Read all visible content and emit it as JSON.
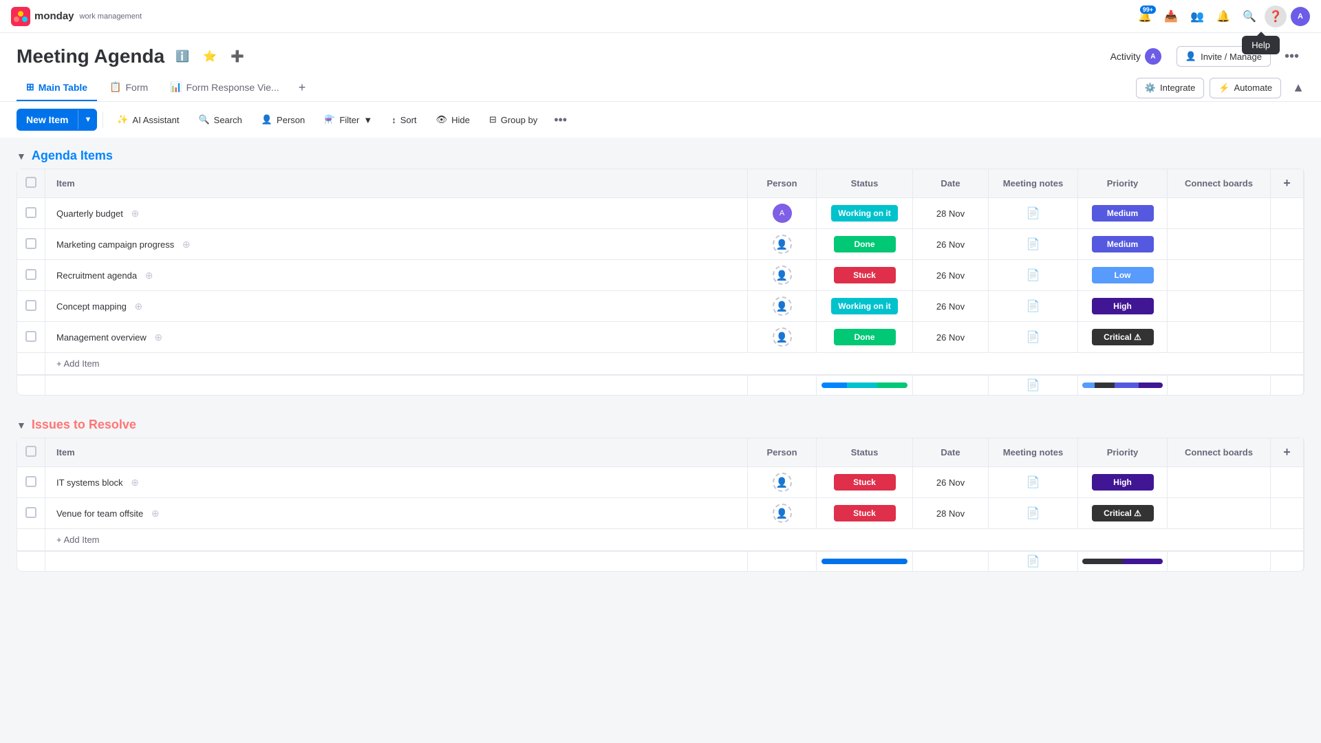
{
  "app": {
    "name": "monday",
    "subtitle": "work management",
    "notification_badge": "99+"
  },
  "header": {
    "title": "Meeting Agenda",
    "activity_label": "Activity",
    "invite_label": "Invite / Manage",
    "help_tooltip": "Help"
  },
  "tabs": [
    {
      "label": "Main Table",
      "icon": "table-icon",
      "active": true
    },
    {
      "label": "Form",
      "icon": "form-icon",
      "active": false
    },
    {
      "label": "Form Response Vie...",
      "icon": "view-icon",
      "active": false
    }
  ],
  "integrate_label": "Integrate",
  "automate_label": "Automate",
  "toolbar": {
    "new_item": "New Item",
    "ai_assistant": "AI Assistant",
    "search": "Search",
    "person": "Person",
    "filter": "Filter",
    "sort": "Sort",
    "hide": "Hide",
    "group_by": "Group by"
  },
  "groups": [
    {
      "id": "agenda",
      "title": "Agenda Items",
      "color": "#0085ff",
      "columns": [
        "Item",
        "Person",
        "Status",
        "Date",
        "Meeting notes",
        "Priority",
        "Connect boards"
      ],
      "rows": [
        {
          "item": "Quarterly budget",
          "person": "avatar",
          "status": "Working on it",
          "status_class": "status-working",
          "date": "28 Nov",
          "has_note": true,
          "priority": "Medium",
          "priority_class": "priority-medium"
        },
        {
          "item": "Marketing campaign progress",
          "person": "empty",
          "status": "Done",
          "status_class": "status-done",
          "date": "26 Nov",
          "has_note": false,
          "priority": "Medium",
          "priority_class": "priority-medium"
        },
        {
          "item": "Recruitment agenda",
          "person": "empty",
          "status": "Stuck",
          "status_class": "status-stuck",
          "date": "26 Nov",
          "has_note": false,
          "priority": "Low",
          "priority_class": "priority-low"
        },
        {
          "item": "Concept mapping",
          "person": "empty",
          "status": "Working on it",
          "status_class": "status-working",
          "date": "26 Nov",
          "has_note": false,
          "priority": "High",
          "priority_class": "priority-high"
        },
        {
          "item": "Management overview",
          "person": "empty",
          "status": "Done",
          "status_class": "status-done",
          "date": "26 Nov",
          "has_note": false,
          "priority": "Critical ⚠",
          "priority_class": "priority-critical"
        }
      ],
      "add_item_label": "+ Add Item",
      "status_bar": [
        {
          "color": "#0085ff",
          "pct": 30
        },
        {
          "color": "#00c2cd",
          "pct": 35
        },
        {
          "color": "#00c875",
          "pct": 35
        }
      ],
      "priority_bar": [
        {
          "color": "#579bfc",
          "pct": 15
        },
        {
          "color": "#323338",
          "pct": 25
        },
        {
          "color": "#5559df",
          "pct": 30
        },
        {
          "color": "#401694",
          "pct": 30
        }
      ]
    },
    {
      "id": "issues",
      "title": "Issues to Resolve",
      "color": "#ff7575",
      "columns": [
        "Item",
        "Person",
        "Status",
        "Date",
        "Meeting notes",
        "Priority",
        "Connect boards"
      ],
      "rows": [
        {
          "item": "IT systems block",
          "person": "empty",
          "status": "Stuck",
          "status_class": "status-stuck",
          "date": "26 Nov",
          "has_note": false,
          "priority": "High",
          "priority_class": "priority-high"
        },
        {
          "item": "Venue for team offsite",
          "person": "empty",
          "status": "Stuck",
          "status_class": "status-stuck",
          "date": "28 Nov",
          "has_note": false,
          "priority": "Critical ⚠",
          "priority_class": "priority-critical"
        }
      ],
      "add_item_label": "+ Add Item",
      "status_bar": [
        {
          "color": "#0073ea",
          "pct": 100
        }
      ],
      "priority_bar": [
        {
          "color": "#323338",
          "pct": 50
        },
        {
          "color": "#401694",
          "pct": 50
        }
      ]
    }
  ]
}
